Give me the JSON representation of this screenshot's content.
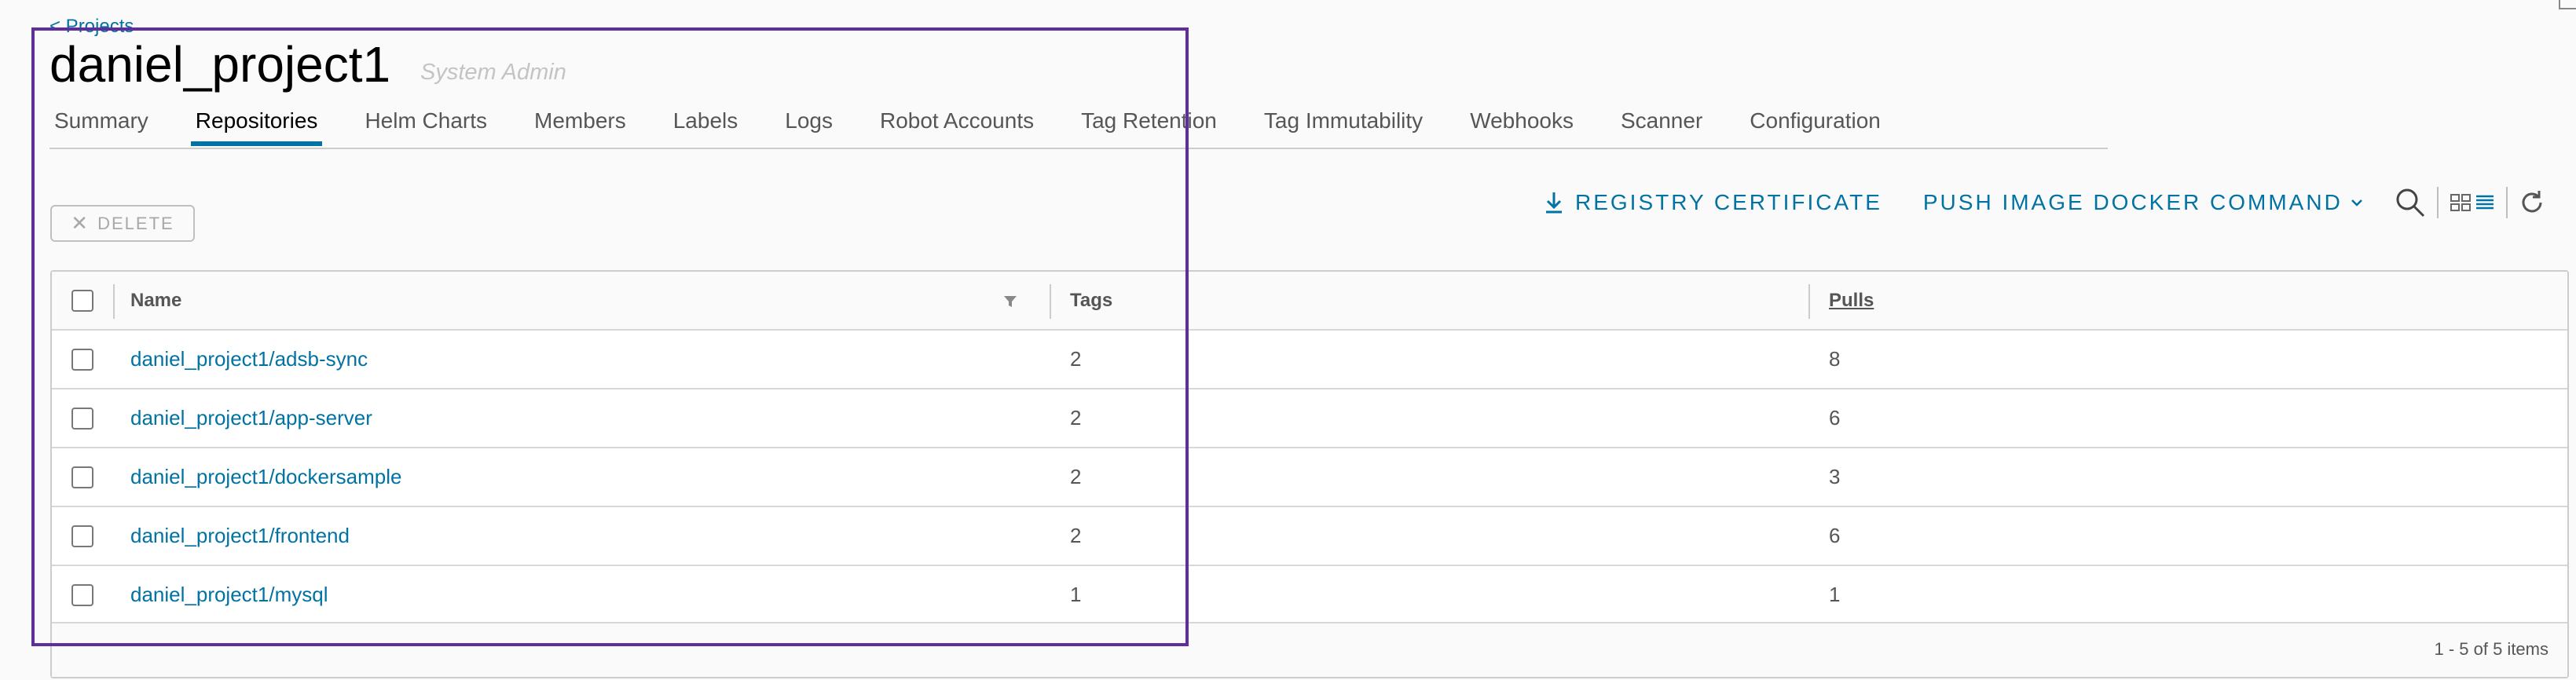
{
  "nav": {
    "back_label": "< Projects"
  },
  "project": {
    "title": "daniel_project1",
    "role": "System Admin"
  },
  "tabs": [
    {
      "label": "Summary",
      "active": false
    },
    {
      "label": "Repositories",
      "active": true
    },
    {
      "label": "Helm Charts",
      "active": false
    },
    {
      "label": "Members",
      "active": false
    },
    {
      "label": "Labels",
      "active": false
    },
    {
      "label": "Logs",
      "active": false
    },
    {
      "label": "Robot Accounts",
      "active": false
    },
    {
      "label": "Tag Retention",
      "active": false
    },
    {
      "label": "Tag Immutability",
      "active": false
    },
    {
      "label": "Webhooks",
      "active": false
    },
    {
      "label": "Scanner",
      "active": false
    },
    {
      "label": "Configuration",
      "active": false
    }
  ],
  "toolbar": {
    "delete_label": "DELETE",
    "registry_certificate_label": "REGISTRY CERTIFICATE",
    "push_image_label": "PUSH IMAGE DOCKER COMMAND",
    "search_icon": "search-icon",
    "card_view_icon": "card-view-icon",
    "list_view_icon": "list-view-icon",
    "refresh_icon": "refresh-icon"
  },
  "table": {
    "columns": [
      "Name",
      "Tags",
      "Pulls"
    ],
    "rows": [
      {
        "name": "daniel_project1/adsb-sync",
        "tags": "2",
        "pulls": "8"
      },
      {
        "name": "daniel_project1/app-server",
        "tags": "2",
        "pulls": "6"
      },
      {
        "name": "daniel_project1/dockersample",
        "tags": "2",
        "pulls": "3"
      },
      {
        "name": "daniel_project1/frontend",
        "tags": "2",
        "pulls": "6"
      },
      {
        "name": "daniel_project1/mysql",
        "tags": "1",
        "pulls": "1"
      }
    ],
    "pagination": "1 - 5 of 5 items"
  },
  "colors": {
    "accent": "#0072a3",
    "focus_outline": "#5f2e9c"
  }
}
